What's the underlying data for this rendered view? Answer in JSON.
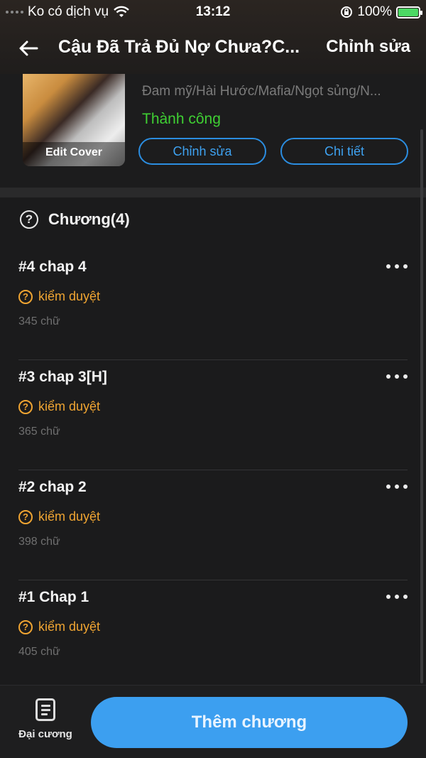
{
  "status_bar": {
    "carrier": "Ko có dịch vụ",
    "time": "13:12",
    "battery": "100%"
  },
  "header": {
    "title": "Cậu Đã Trả Đủ Nợ Chưa?C...",
    "edit_label": "Chỉnh sửa"
  },
  "book": {
    "edit_cover_label": "Edit Cover",
    "genres": "Đam mỹ/Hài Hước/Mafia/Ngọt sủng/N...",
    "status": "Thành công",
    "status_color": "#3fcf33",
    "edit_button": "Chỉnh sửa",
    "detail_button": "Chi tiết"
  },
  "chapters": {
    "heading": "Chương(4)",
    "items": [
      {
        "name": "#4 chap 4",
        "review": "kiểm duyệt",
        "words": "345 chữ"
      },
      {
        "name": "#3 chap 3[H]",
        "review": "kiểm duyệt",
        "words": "365 chữ"
      },
      {
        "name": "#2 chap 2",
        "review": "kiểm duyệt",
        "words": "398 chữ"
      },
      {
        "name": "#1 Chap 1",
        "review": "kiểm duyệt",
        "words": "405 chữ"
      }
    ]
  },
  "bottom_bar": {
    "outline_label": "Đại cương",
    "add_chapter_label": "Thêm chương",
    "accent_color": "#3c9ff0"
  }
}
